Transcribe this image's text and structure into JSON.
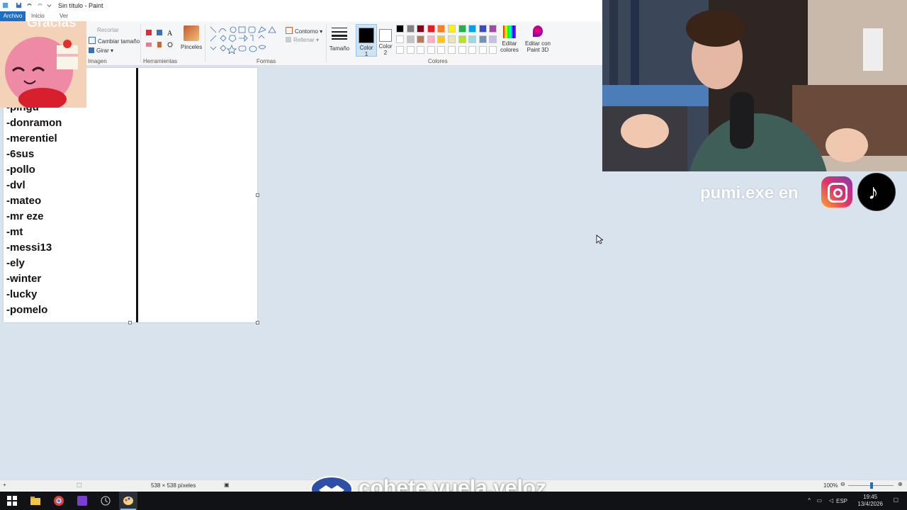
{
  "window": {
    "title": "Sin título - Paint"
  },
  "tabs": {
    "archivo": "Archivo",
    "inicio": "Inicio",
    "ver": "Ver"
  },
  "ribbon": {
    "imagen": {
      "label": "Imagen",
      "recortar": "Recortar",
      "cambiar_tamano": "Cambiar tamaño",
      "girar": "Girar"
    },
    "herramientas": {
      "label": "Herramientas"
    },
    "pinceles": "Pinceles",
    "formas": {
      "label": "Formas",
      "contorno": "Contorno",
      "rellenar": "Rellenar"
    },
    "tamano": "Tamaño",
    "color1": {
      "line1": "Color",
      "line2": "1"
    },
    "color2": {
      "line1": "Color",
      "line2": "2"
    },
    "colores_label": "Colores",
    "editar_colores": {
      "line1": "Editar",
      "line2": "colores"
    },
    "editar_paint3d": {
      "line1": "Editar con",
      "line2": "Paint 3D"
    },
    "palette_row1": [
      "#000000",
      "#7f7f7f",
      "#880015",
      "#ed1c24",
      "#ff7f27",
      "#fff200",
      "#22b14c",
      "#00a2e8",
      "#3f48cc",
      "#a349a4"
    ],
    "palette_row2": [
      "#ffffff",
      "#c3c3c3",
      "#b97a57",
      "#ffaec9",
      "#ffc90e",
      "#efe4b0",
      "#b5e61d",
      "#99d9ea",
      "#7092be",
      "#c8bfe7"
    ]
  },
  "canvas": {
    "names": [
      "-pingu",
      "-donramon",
      "-merentiel",
      "-6sus",
      "-pollo",
      "-dvl",
      "-mateo",
      "-mr eze",
      "-mt",
      "-messi13",
      "-ely",
      "-winter",
      "-lucky",
      "-pomelo"
    ]
  },
  "overlay": {
    "gracias": "Gracias",
    "social": "pumi.exe en",
    "promo": "cohete.vuela.veloz"
  },
  "statusbar": {
    "dimensions": "538 × 538 píxeles",
    "zoom": "100%"
  },
  "taskbar": {
    "lang": "ESP",
    "time": "19:45",
    "date": "13/4/2026"
  }
}
